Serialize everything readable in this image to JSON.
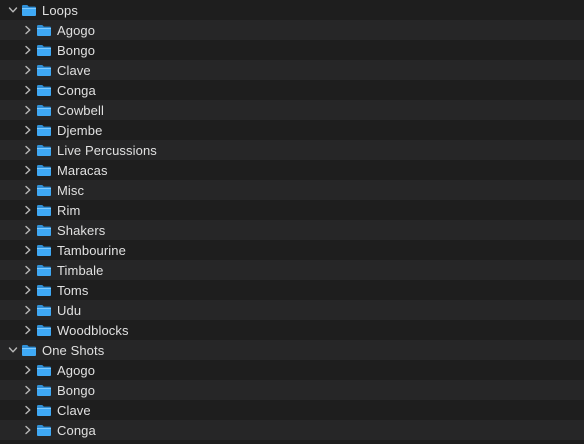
{
  "icons": {
    "expanded": "chevron-down-icon",
    "collapsed": "chevron-right-icon",
    "folder": "folder-icon"
  },
  "colors": {
    "background": "#1e1e1e",
    "row_alt": "#262627",
    "text": "#e0e0e0",
    "folder": "#3fa9f5"
  },
  "tree": [
    {
      "label": "Loops",
      "expanded": true,
      "children": [
        {
          "label": "Agogo"
        },
        {
          "label": "Bongo"
        },
        {
          "label": "Clave"
        },
        {
          "label": "Conga"
        },
        {
          "label": "Cowbell"
        },
        {
          "label": "Djembe"
        },
        {
          "label": "Live Percussions"
        },
        {
          "label": "Maracas"
        },
        {
          "label": "Misc"
        },
        {
          "label": "Rim"
        },
        {
          "label": "Shakers"
        },
        {
          "label": "Tambourine"
        },
        {
          "label": "Timbale"
        },
        {
          "label": "Toms"
        },
        {
          "label": "Udu"
        },
        {
          "label": "Woodblocks"
        }
      ]
    },
    {
      "label": "One Shots",
      "expanded": true,
      "children": [
        {
          "label": "Agogo"
        },
        {
          "label": "Bongo"
        },
        {
          "label": "Clave"
        },
        {
          "label": "Conga"
        }
      ]
    }
  ]
}
